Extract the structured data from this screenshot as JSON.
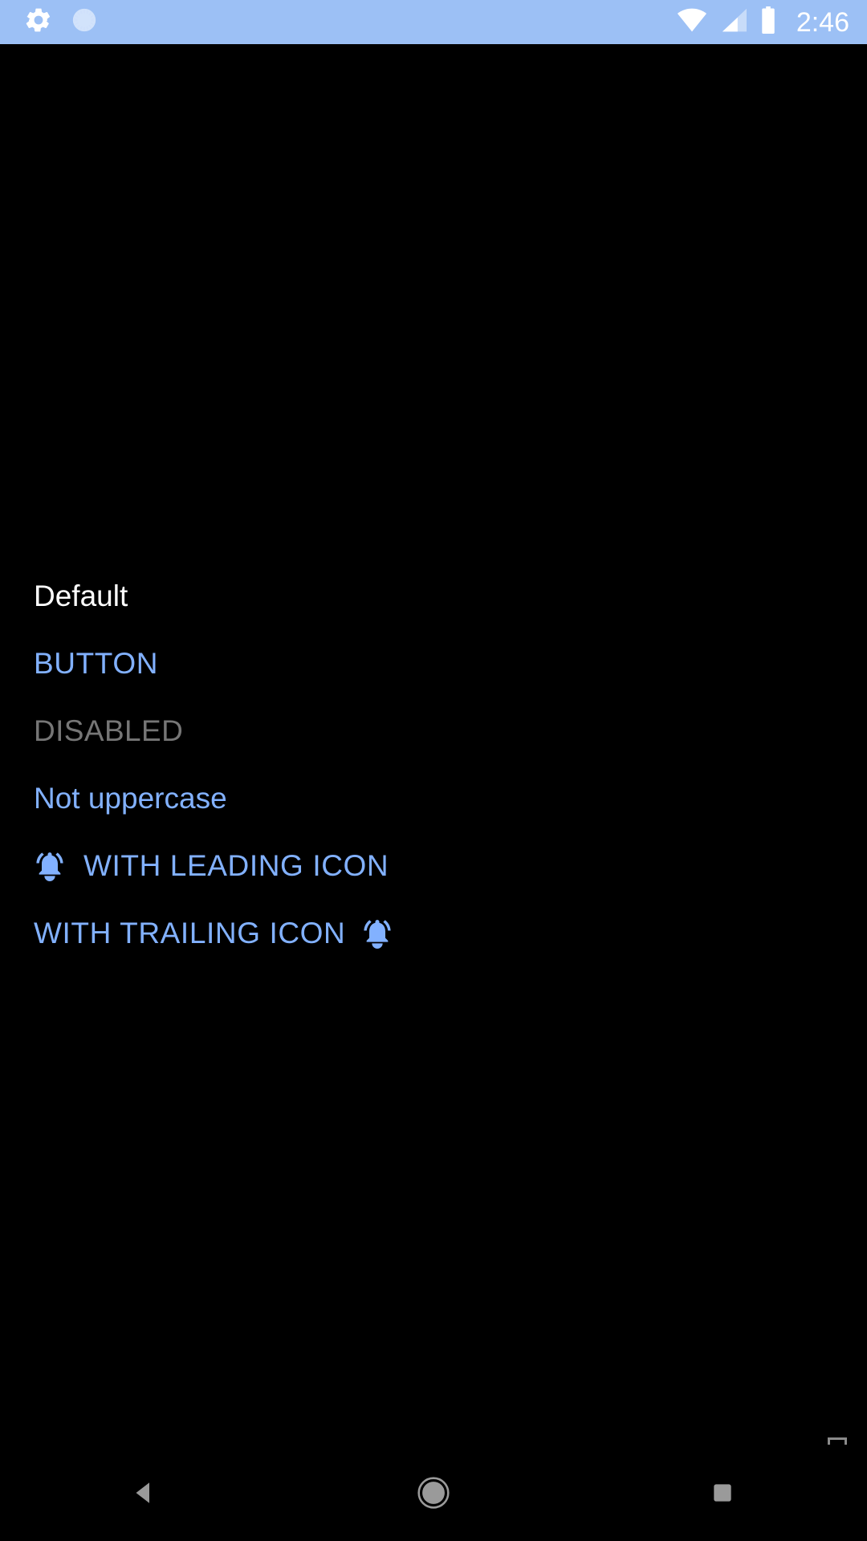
{
  "status_bar": {
    "background_color": "#9cc0f5",
    "foreground_color": "#ffffff",
    "clock": "2:46",
    "left_icons": [
      {
        "name": "settings-gear-icon",
        "label": "Settings"
      },
      {
        "name": "sync-progress-icon",
        "label": "Syncing"
      }
    ],
    "right_icons": [
      {
        "name": "wifi-icon",
        "label": "Wi-Fi"
      },
      {
        "name": "cellular-signal-icon",
        "label": "Mobile signal"
      },
      {
        "name": "battery-icon",
        "label": "Battery"
      }
    ]
  },
  "screen": {
    "background_color": "#000000",
    "accent_color": "#82b1ff",
    "disabled_color": "#767676",
    "default_text_color": "#ffffff"
  },
  "buttons": [
    {
      "id": "default",
      "label": "Default",
      "style": "default",
      "enabled": true,
      "leading_icon": null,
      "trailing_icon": null
    },
    {
      "id": "button",
      "label": "BUTTON",
      "style": "accent",
      "enabled": true,
      "leading_icon": null,
      "trailing_icon": null
    },
    {
      "id": "disabled",
      "label": "DISABLED",
      "style": "disabled",
      "enabled": false,
      "leading_icon": null,
      "trailing_icon": null
    },
    {
      "id": "not-uppercase",
      "label": "Not uppercase",
      "style": "mixed",
      "enabled": true,
      "leading_icon": null,
      "trailing_icon": null
    },
    {
      "id": "with-leading-icon",
      "label": "WITH LEADING ICON",
      "style": "accent",
      "enabled": true,
      "leading_icon": "notifications-active-bell-icon",
      "trailing_icon": null
    },
    {
      "id": "with-trailing-icon",
      "label": "WITH TRAILING ICON",
      "style": "accent",
      "enabled": true,
      "leading_icon": null,
      "trailing_icon": "notifications-active-bell-icon"
    }
  ],
  "overlay": {
    "resize_handle": {
      "name": "resize-handle-square",
      "color": "#8a8a8a"
    }
  },
  "nav_bar": {
    "background_color": "#000000",
    "icon_color": "#9a9a9a",
    "items": [
      {
        "name": "nav-back-button",
        "label": "Back"
      },
      {
        "name": "nav-home-button",
        "label": "Home"
      },
      {
        "name": "nav-recents-button",
        "label": "Recents"
      }
    ]
  }
}
